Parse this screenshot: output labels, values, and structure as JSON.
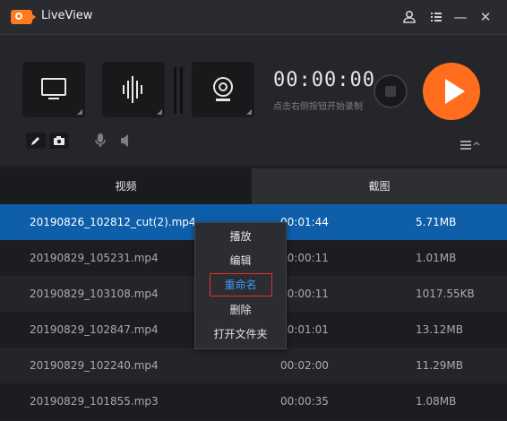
{
  "app": {
    "title": "LiveView"
  },
  "titlebar": {
    "icons": [
      "user-icon",
      "list-icon",
      "minimize-icon",
      "close-icon"
    ],
    "minimize_glyph": "—",
    "close_glyph": "✕"
  },
  "recorder": {
    "sources": [
      "screen-icon",
      "audio-wave-icon",
      "webcam-icon"
    ],
    "timer": "00:00:00",
    "hint": "点击右侧按钮开始录制",
    "tools": [
      "pencil-icon",
      "camera-icon",
      "microphone-icon",
      "speaker-icon",
      "menu-icon"
    ],
    "accent": "#ff6d1d"
  },
  "tabs": [
    {
      "label": "视频",
      "active": true
    },
    {
      "label": "截图",
      "active": false
    }
  ],
  "files": [
    {
      "name": "20190826_102812_cut(2).mp4",
      "duration": "00:01:44",
      "size": "5.71MB",
      "selected": true
    },
    {
      "name": "20190829_105231.mp4",
      "duration": "00:00:11",
      "size": "1.01MB"
    },
    {
      "name": "20190829_103108.mp4",
      "duration": "00:00:11",
      "size": "1017.55KB"
    },
    {
      "name": "20190829_102847.mp4",
      "duration": "00:01:01",
      "size": "13.12MB"
    },
    {
      "name": "20190829_102240.mp4",
      "duration": "00:02:00",
      "size": "11.29MB"
    },
    {
      "name": "20190829_101855.mp3",
      "duration": "00:00:35",
      "size": "1.08MB"
    }
  ],
  "context_menu": {
    "items": [
      "播放",
      "编辑",
      "重命名",
      "删除",
      "打开文件夹"
    ],
    "highlighted": "重命名"
  },
  "colors": {
    "selection": "#0e5ea9",
    "highlight_border": "#e0322c"
  }
}
